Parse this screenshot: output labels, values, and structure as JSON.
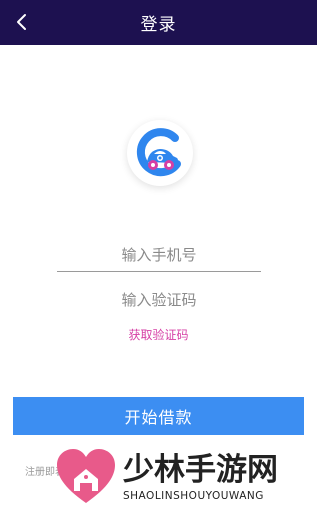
{
  "header": {
    "title": "登录",
    "back_icon": "chevron-left-icon",
    "background": "#1d1150"
  },
  "logo": {
    "icon": "car-logo-icon"
  },
  "phone_field": {
    "placeholder": "输入手机号",
    "value": ""
  },
  "code_field": {
    "placeholder": "输入验证码",
    "value": ""
  },
  "get_code_link": {
    "label": "获取验证码",
    "color": "#d63fa5"
  },
  "start_button": {
    "label": "开始借款",
    "color": "#3c8ef2"
  },
  "agreement": {
    "text": "注册即表示同意"
  },
  "watermark": {
    "title": "少林手游网",
    "subtitle": "SHAOLINSHOUYOUWANG",
    "heart_color": "#e85a8a"
  }
}
